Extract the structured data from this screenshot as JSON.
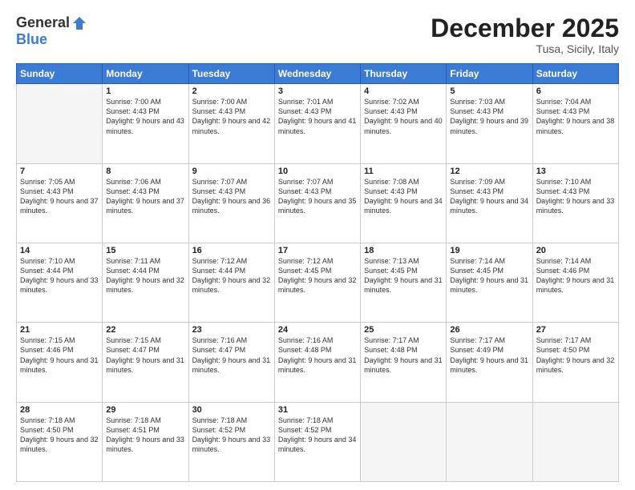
{
  "logo": {
    "general": "General",
    "blue": "Blue"
  },
  "title": "December 2025",
  "location": "Tusa, Sicily, Italy",
  "headers": [
    "Sunday",
    "Monday",
    "Tuesday",
    "Wednesday",
    "Thursday",
    "Friday",
    "Saturday"
  ],
  "weeks": [
    [
      {
        "day": "",
        "sunrise": "",
        "sunset": "",
        "daylight": "",
        "empty": true
      },
      {
        "day": "1",
        "sunrise": "Sunrise: 7:00 AM",
        "sunset": "Sunset: 4:43 PM",
        "daylight": "Daylight: 9 hours and 43 minutes."
      },
      {
        "day": "2",
        "sunrise": "Sunrise: 7:00 AM",
        "sunset": "Sunset: 4:43 PM",
        "daylight": "Daylight: 9 hours and 42 minutes."
      },
      {
        "day": "3",
        "sunrise": "Sunrise: 7:01 AM",
        "sunset": "Sunset: 4:43 PM",
        "daylight": "Daylight: 9 hours and 41 minutes."
      },
      {
        "day": "4",
        "sunrise": "Sunrise: 7:02 AM",
        "sunset": "Sunset: 4:43 PM",
        "daylight": "Daylight: 9 hours and 40 minutes."
      },
      {
        "day": "5",
        "sunrise": "Sunrise: 7:03 AM",
        "sunset": "Sunset: 4:43 PM",
        "daylight": "Daylight: 9 hours and 39 minutes."
      },
      {
        "day": "6",
        "sunrise": "Sunrise: 7:04 AM",
        "sunset": "Sunset: 4:43 PM",
        "daylight": "Daylight: 9 hours and 38 minutes."
      }
    ],
    [
      {
        "day": "7",
        "sunrise": "Sunrise: 7:05 AM",
        "sunset": "Sunset: 4:43 PM",
        "daylight": "Daylight: 9 hours and 37 minutes."
      },
      {
        "day": "8",
        "sunrise": "Sunrise: 7:06 AM",
        "sunset": "Sunset: 4:43 PM",
        "daylight": "Daylight: 9 hours and 37 minutes."
      },
      {
        "day": "9",
        "sunrise": "Sunrise: 7:07 AM",
        "sunset": "Sunset: 4:43 PM",
        "daylight": "Daylight: 9 hours and 36 minutes."
      },
      {
        "day": "10",
        "sunrise": "Sunrise: 7:07 AM",
        "sunset": "Sunset: 4:43 PM",
        "daylight": "Daylight: 9 hours and 35 minutes."
      },
      {
        "day": "11",
        "sunrise": "Sunrise: 7:08 AM",
        "sunset": "Sunset: 4:43 PM",
        "daylight": "Daylight: 9 hours and 34 minutes."
      },
      {
        "day": "12",
        "sunrise": "Sunrise: 7:09 AM",
        "sunset": "Sunset: 4:43 PM",
        "daylight": "Daylight: 9 hours and 34 minutes."
      },
      {
        "day": "13",
        "sunrise": "Sunrise: 7:10 AM",
        "sunset": "Sunset: 4:43 PM",
        "daylight": "Daylight: 9 hours and 33 minutes."
      }
    ],
    [
      {
        "day": "14",
        "sunrise": "Sunrise: 7:10 AM",
        "sunset": "Sunset: 4:44 PM",
        "daylight": "Daylight: 9 hours and 33 minutes."
      },
      {
        "day": "15",
        "sunrise": "Sunrise: 7:11 AM",
        "sunset": "Sunset: 4:44 PM",
        "daylight": "Daylight: 9 hours and 32 minutes."
      },
      {
        "day": "16",
        "sunrise": "Sunrise: 7:12 AM",
        "sunset": "Sunset: 4:44 PM",
        "daylight": "Daylight: 9 hours and 32 minutes."
      },
      {
        "day": "17",
        "sunrise": "Sunrise: 7:12 AM",
        "sunset": "Sunset: 4:45 PM",
        "daylight": "Daylight: 9 hours and 32 minutes."
      },
      {
        "day": "18",
        "sunrise": "Sunrise: 7:13 AM",
        "sunset": "Sunset: 4:45 PM",
        "daylight": "Daylight: 9 hours and 31 minutes."
      },
      {
        "day": "19",
        "sunrise": "Sunrise: 7:14 AM",
        "sunset": "Sunset: 4:45 PM",
        "daylight": "Daylight: 9 hours and 31 minutes."
      },
      {
        "day": "20",
        "sunrise": "Sunrise: 7:14 AM",
        "sunset": "Sunset: 4:46 PM",
        "daylight": "Daylight: 9 hours and 31 minutes."
      }
    ],
    [
      {
        "day": "21",
        "sunrise": "Sunrise: 7:15 AM",
        "sunset": "Sunset: 4:46 PM",
        "daylight": "Daylight: 9 hours and 31 minutes."
      },
      {
        "day": "22",
        "sunrise": "Sunrise: 7:15 AM",
        "sunset": "Sunset: 4:47 PM",
        "daylight": "Daylight: 9 hours and 31 minutes."
      },
      {
        "day": "23",
        "sunrise": "Sunrise: 7:16 AM",
        "sunset": "Sunset: 4:47 PM",
        "daylight": "Daylight: 9 hours and 31 minutes."
      },
      {
        "day": "24",
        "sunrise": "Sunrise: 7:16 AM",
        "sunset": "Sunset: 4:48 PM",
        "daylight": "Daylight: 9 hours and 31 minutes."
      },
      {
        "day": "25",
        "sunrise": "Sunrise: 7:17 AM",
        "sunset": "Sunset: 4:48 PM",
        "daylight": "Daylight: 9 hours and 31 minutes."
      },
      {
        "day": "26",
        "sunrise": "Sunrise: 7:17 AM",
        "sunset": "Sunset: 4:49 PM",
        "daylight": "Daylight: 9 hours and 31 minutes."
      },
      {
        "day": "27",
        "sunrise": "Sunrise: 7:17 AM",
        "sunset": "Sunset: 4:50 PM",
        "daylight": "Daylight: 9 hours and 32 minutes."
      }
    ],
    [
      {
        "day": "28",
        "sunrise": "Sunrise: 7:18 AM",
        "sunset": "Sunset: 4:50 PM",
        "daylight": "Daylight: 9 hours and 32 minutes."
      },
      {
        "day": "29",
        "sunrise": "Sunrise: 7:18 AM",
        "sunset": "Sunset: 4:51 PM",
        "daylight": "Daylight: 9 hours and 33 minutes."
      },
      {
        "day": "30",
        "sunrise": "Sunrise: 7:18 AM",
        "sunset": "Sunset: 4:52 PM",
        "daylight": "Daylight: 9 hours and 33 minutes."
      },
      {
        "day": "31",
        "sunrise": "Sunrise: 7:18 AM",
        "sunset": "Sunset: 4:52 PM",
        "daylight": "Daylight: 9 hours and 34 minutes."
      },
      {
        "day": "",
        "sunrise": "",
        "sunset": "",
        "daylight": "",
        "empty": true
      },
      {
        "day": "",
        "sunrise": "",
        "sunset": "",
        "daylight": "",
        "empty": true
      },
      {
        "day": "",
        "sunrise": "",
        "sunset": "",
        "daylight": "",
        "empty": true
      }
    ]
  ]
}
